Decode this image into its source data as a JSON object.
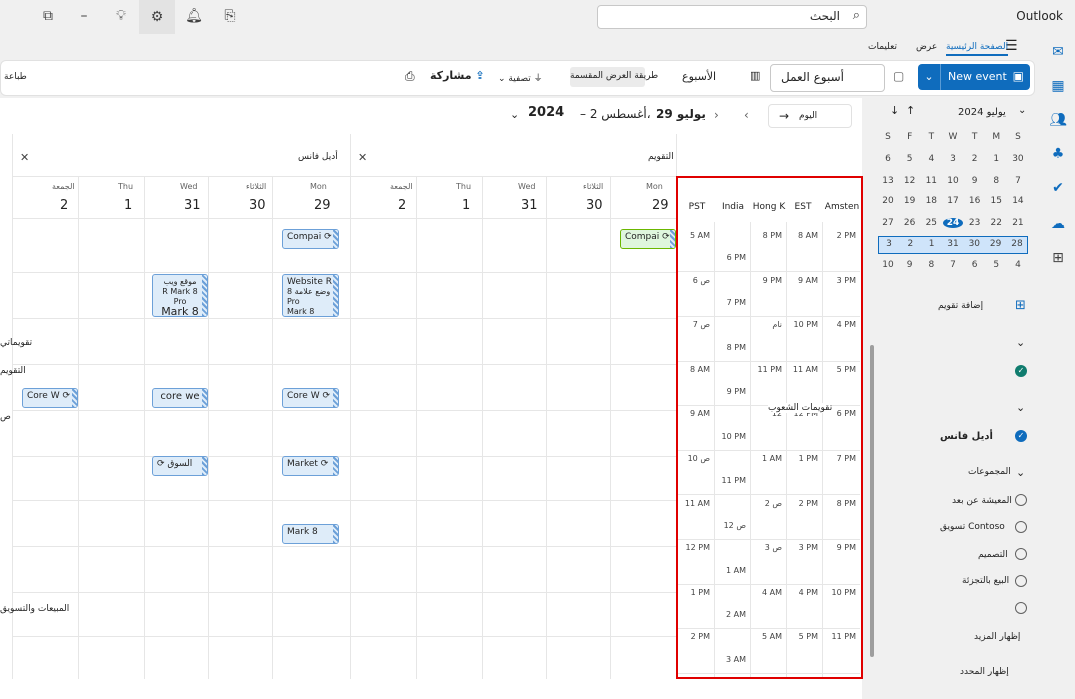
{
  "app": {
    "title": "Outlook"
  },
  "search": {
    "value": "البحث"
  },
  "ribbon_tabs": [
    "الصفحة الرئيسية",
    "عرض",
    "تعليمات"
  ],
  "ribbon": {
    "new_event": "New event",
    "work_week": "أسبوع العمل",
    "week": "الأسبوع",
    "split_view": "طريقة العرض المقسمة",
    "filter": "تصفية",
    "share": "مشاركة",
    "print": "طباعة"
  },
  "nav": {
    "today": "اليوم",
    "range_days": "29 يوليو",
    "range_end": "– 2 أغسطس،",
    "range_year": "2024"
  },
  "mini_calendar": {
    "month_label": "يوليو 2024",
    "weekdays": [
      "S",
      "M",
      "T",
      "W",
      "T",
      "F",
      "S"
    ],
    "weeks": [
      [
        "30",
        "1",
        "2",
        "3",
        "4",
        "5",
        "6"
      ],
      [
        "7",
        "8",
        "9",
        "10",
        "11",
        "12",
        "13"
      ],
      [
        "14",
        "15",
        "16",
        "17",
        "18",
        "19",
        "20"
      ],
      [
        "21",
        "22",
        "23",
        "24",
        "25",
        "26",
        "27"
      ],
      [
        "28",
        "29",
        "30",
        "31",
        "1",
        "2",
        "3"
      ],
      [
        "4",
        "5",
        "6",
        "7",
        "8",
        "9",
        "10"
      ]
    ],
    "selected_day": "24"
  },
  "left_pane": {
    "add_calendar": "إضافة تقويم",
    "owner": "أديل فانس",
    "groups": "المجموعات",
    "group_items": [
      "المعيشة عن بعد",
      "تسويق Contoso",
      "التصميم",
      "البيع بالتجزئة"
    ],
    "show_more": "إظهار المزيد",
    "show_less": "إظهار المحدد"
  },
  "panes": {
    "calendar_title": "التقويم",
    "owner_title": "أديل فانس",
    "days": [
      {
        "name": "Mon",
        "num": "29"
      },
      {
        "name": "الثلاثاء",
        "num": "30"
      },
      {
        "name": "Wed",
        "num": "31"
      },
      {
        "name": "Thu",
        "num": "1"
      },
      {
        "name": "الجمعة",
        "num": "2"
      }
    ]
  },
  "timezones": {
    "headers": [
      "Amsten",
      "EST",
      "Hong K",
      "India",
      "PST"
    ],
    "rows": [
      [
        "2 PM",
        "8 AM",
        "8 PM",
        "",
        "5 AM"
      ],
      [
        "",
        "",
        "",
        "6 PM",
        ""
      ],
      [
        "3 PM",
        "9 AM",
        "9 PM",
        "",
        "6 ص"
      ],
      [
        "",
        "",
        "",
        "7 PM",
        ""
      ],
      [
        "4 PM",
        "10 PM",
        "نام",
        "",
        "7 ص"
      ],
      [
        "",
        "",
        "",
        "8 PM",
        ""
      ],
      [
        "5 PM",
        "11 AM",
        "11 PM",
        "",
        "8 AM"
      ],
      [
        "",
        "",
        "",
        "9 PM",
        ""
      ],
      [
        "6 PM",
        "12 PM",
        "12",
        "",
        "9 AM"
      ],
      [
        "",
        "",
        "",
        "10 PM",
        ""
      ],
      [
        "7 PM",
        "1 PM",
        "1 AM",
        "",
        "10 ص"
      ],
      [
        "",
        "",
        "",
        "11 PM",
        ""
      ],
      [
        "8 PM",
        "2 PM",
        "2 ص",
        "",
        "11 AM"
      ],
      [
        "",
        "",
        "",
        "12 ص",
        ""
      ],
      [
        "9 PM",
        "3 PM",
        "3 ص",
        "",
        "12 PM"
      ],
      [
        "",
        "",
        "",
        "1 AM",
        ""
      ],
      [
        "10 PM",
        "4 PM",
        "4 AM",
        "",
        "1 PM"
      ],
      [
        "",
        "",
        "",
        "2 AM",
        ""
      ],
      [
        "11 PM",
        "5 PM",
        "5 AM",
        "",
        "2 PM"
      ],
      [
        "",
        "",
        "",
        "3 AM",
        ""
      ]
    ],
    "overlay": "تقويمات الشعوب"
  },
  "events_main": [
    {
      "label": "Compai"
    }
  ],
  "events_owner": [
    {
      "label": "Compai"
    },
    {
      "label": "Website R",
      "sub1": "وضع علامة 8 Pro",
      "sub2": "Mark 8"
    },
    {
      "label": "موقع ويب",
      "sub1": "R Mark 8 Pro",
      "sub2": "Mark 8 e"
    },
    {
      "label": "Core W"
    },
    {
      "label": "core we"
    },
    {
      "label": "Core W"
    },
    {
      "label": "Market"
    },
    {
      "label": "السوق"
    },
    {
      "label": "Mark 8"
    }
  ],
  "side_labels": {
    "a": "تقويماتي",
    "b": "التقويم",
    "c": "ص",
    "d": "المبيعات والتسويق"
  },
  "colors": {
    "accent": "#0f6cbd",
    "highlight": "#e00000",
    "event_bg": "#deecf9"
  }
}
